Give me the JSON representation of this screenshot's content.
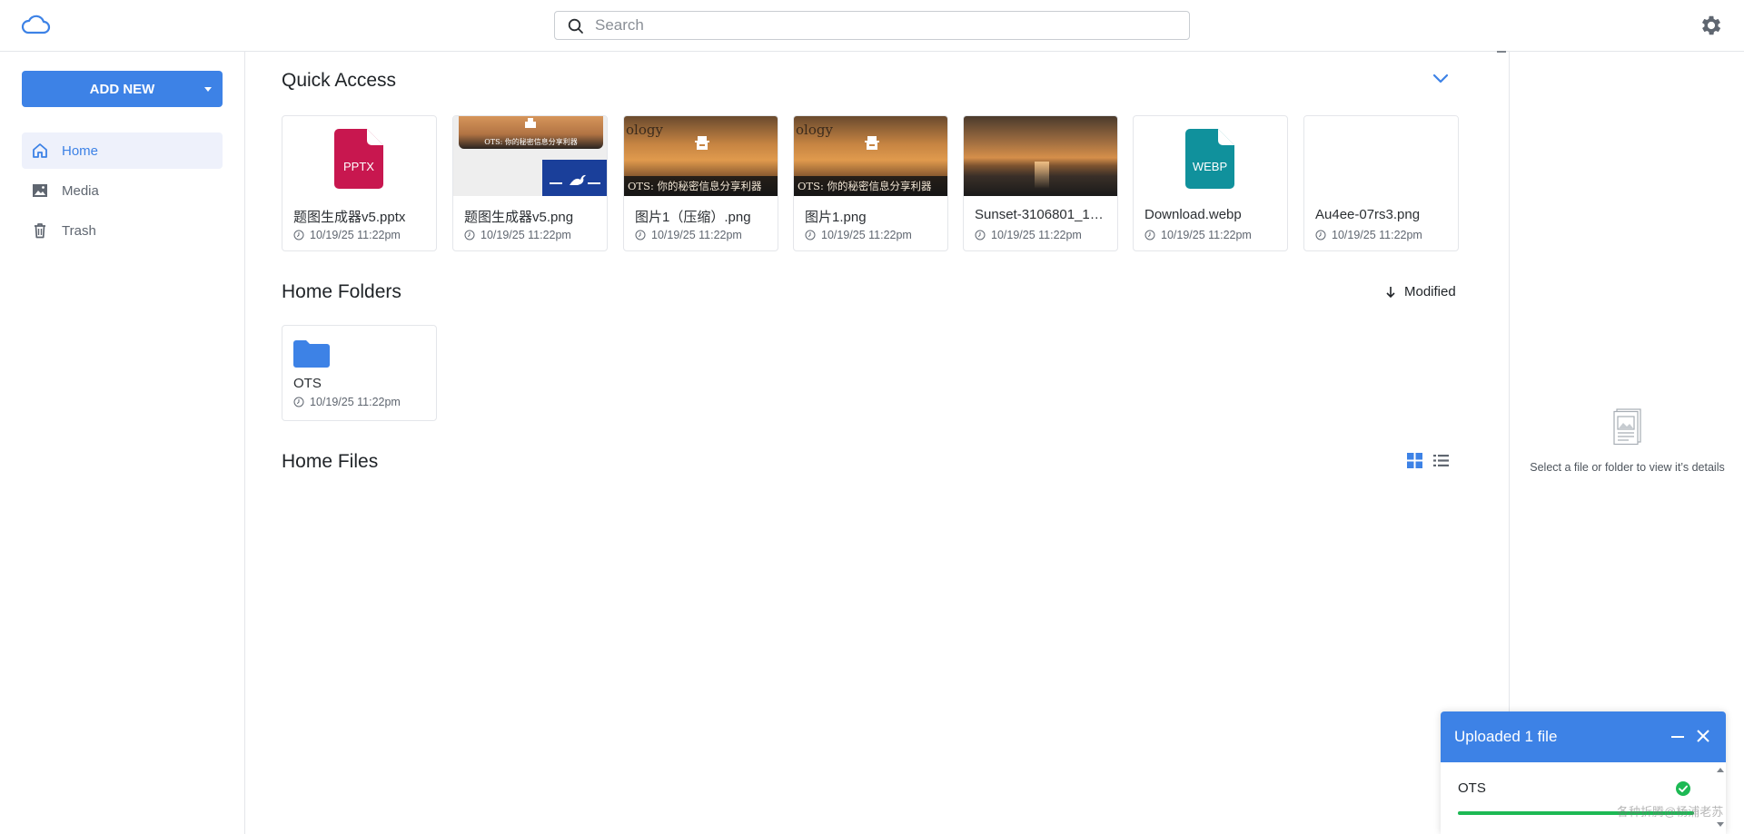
{
  "header": {
    "search_placeholder": "Search",
    "icons": {
      "logo": "cloud-icon",
      "settings": "gear-icon",
      "search": "search-icon"
    }
  },
  "sidebar": {
    "add_new_label": "ADD NEW",
    "items": [
      {
        "label": "Home",
        "icon": "home-icon",
        "active": true
      },
      {
        "label": "Media",
        "icon": "image-icon",
        "active": false
      },
      {
        "label": "Trash",
        "icon": "trash-icon",
        "active": false
      }
    ]
  },
  "main": {
    "quick_access": {
      "title": "Quick Access",
      "files": [
        {
          "name": "题图生成器v5.pptx",
          "date": "10/19/25 11:22pm",
          "kind": "pptx",
          "badge": "PPTX"
        },
        {
          "name": "题图生成器v5.png",
          "date": "10/19/25 11:22pm",
          "kind": "collage",
          "banner": "OTS: 你的秘密信息分享利器"
        },
        {
          "name": "图片1（压缩）.png",
          "date": "10/19/25 11:22pm",
          "kind": "banner",
          "banner": "OTS: 你的秘密信息分享利器",
          "caption": "ology"
        },
        {
          "name": "图片1.png",
          "date": "10/19/25 11:22pm",
          "kind": "banner",
          "banner": "OTS: 你的秘密信息分享利器",
          "caption": "ology"
        },
        {
          "name": "Sunset-3106801_19…",
          "date": "10/19/25 11:22pm",
          "kind": "sunset"
        },
        {
          "name": "Download.webp",
          "date": "10/19/25 11:22pm",
          "kind": "webp",
          "badge": "WEBP"
        },
        {
          "name": "Au4ee-07rs3.png",
          "date": "10/19/25 11:22pm",
          "kind": "blank"
        }
      ]
    },
    "home_folders": {
      "title": "Home Folders",
      "sort_label": "Modified",
      "folders": [
        {
          "name": "OTS",
          "date": "10/19/25 11:22pm"
        }
      ]
    },
    "home_files": {
      "title": "Home Files"
    }
  },
  "details": {
    "message": "Select a file or folder to view it’s details"
  },
  "upload": {
    "title": "Uploaded 1 file",
    "items": [
      {
        "name": "OTS",
        "progress": 1.0
      }
    ]
  },
  "watermark": "各种折腾@杨浦老苏",
  "colors": {
    "accent": "#3d82e6",
    "pptx": "#c8174f",
    "webp": "#10919c",
    "success": "#1db954"
  }
}
